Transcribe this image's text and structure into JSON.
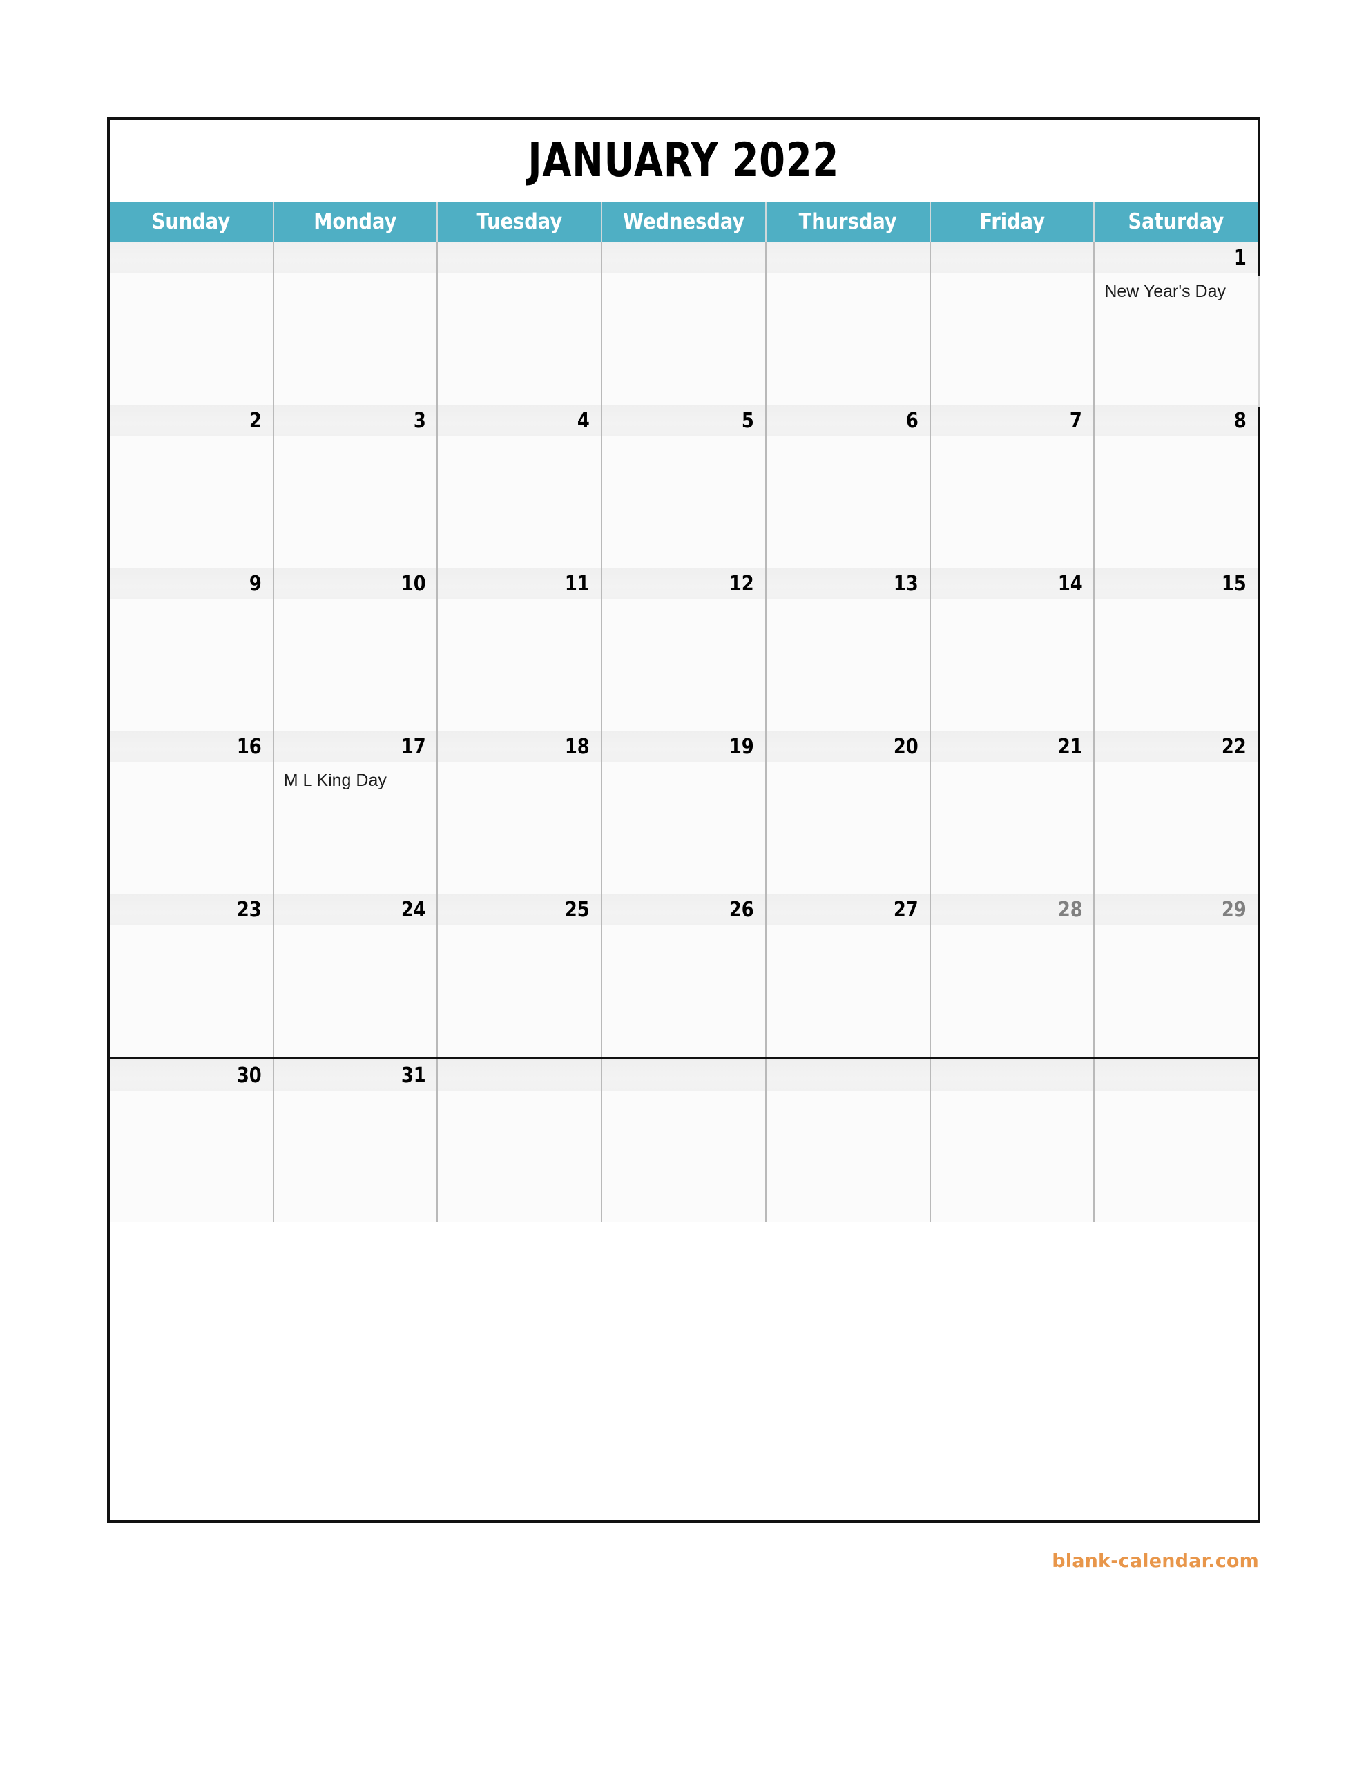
{
  "title": "JANUARY 2022",
  "weekdays": [
    "Sunday",
    "Monday",
    "Tuesday",
    "Wednesday",
    "Thursday",
    "Friday",
    "Saturday"
  ],
  "colors": {
    "header_background": "#4FAFC4",
    "header_text": "#FFFFFF",
    "date_band": "#F1F1F1",
    "cell_background": "#FBFBFB",
    "border": "#111111",
    "grid_line": "#B9B9B9",
    "date_text": "#000000",
    "date_text_muted": "#808080",
    "watermark": "#E8964A"
  },
  "watermark": "blank-calendar.com",
  "weeks": [
    {
      "tall": true,
      "thick_top": false,
      "days": [
        {
          "date": "",
          "event": "",
          "muted": false
        },
        {
          "date": "",
          "event": "",
          "muted": false
        },
        {
          "date": "",
          "event": "",
          "muted": false
        },
        {
          "date": "",
          "event": "",
          "muted": false
        },
        {
          "date": "",
          "event": "",
          "muted": false
        },
        {
          "date": "",
          "event": "",
          "muted": false
        },
        {
          "date": "1",
          "event": "New Year's Day",
          "muted": false
        }
      ]
    },
    {
      "tall": true,
      "thick_top": false,
      "days": [
        {
          "date": "2",
          "event": "",
          "muted": false
        },
        {
          "date": "3",
          "event": "",
          "muted": false
        },
        {
          "date": "4",
          "event": "",
          "muted": false
        },
        {
          "date": "5",
          "event": "",
          "muted": false
        },
        {
          "date": "6",
          "event": "",
          "muted": false
        },
        {
          "date": "7",
          "event": "",
          "muted": false
        },
        {
          "date": "8",
          "event": "",
          "muted": false
        }
      ]
    },
    {
      "tall": true,
      "thick_top": false,
      "days": [
        {
          "date": "9",
          "event": "",
          "muted": false
        },
        {
          "date": "10",
          "event": "",
          "muted": false
        },
        {
          "date": "11",
          "event": "",
          "muted": false
        },
        {
          "date": "12",
          "event": "",
          "muted": false
        },
        {
          "date": "13",
          "event": "",
          "muted": false
        },
        {
          "date": "14",
          "event": "",
          "muted": false
        },
        {
          "date": "15",
          "event": "",
          "muted": false
        }
      ]
    },
    {
      "tall": true,
      "thick_top": false,
      "days": [
        {
          "date": "16",
          "event": "",
          "muted": false
        },
        {
          "date": "17",
          "event": "M L King Day",
          "muted": false
        },
        {
          "date": "18",
          "event": "",
          "muted": false
        },
        {
          "date": "19",
          "event": "",
          "muted": false
        },
        {
          "date": "20",
          "event": "",
          "muted": false
        },
        {
          "date": "21",
          "event": "",
          "muted": false
        },
        {
          "date": "22",
          "event": "",
          "muted": false
        }
      ]
    },
    {
      "tall": true,
      "thick_top": false,
      "days": [
        {
          "date": "23",
          "event": "",
          "muted": false
        },
        {
          "date": "24",
          "event": "",
          "muted": false
        },
        {
          "date": "25",
          "event": "",
          "muted": false
        },
        {
          "date": "26",
          "event": "",
          "muted": false
        },
        {
          "date": "27",
          "event": "",
          "muted": false
        },
        {
          "date": "28",
          "event": "",
          "muted": true
        },
        {
          "date": "29",
          "event": "",
          "muted": true
        }
      ]
    },
    {
      "tall": true,
      "thick_top": true,
      "days": [
        {
          "date": "30",
          "event": "",
          "muted": false
        },
        {
          "date": "31",
          "event": "",
          "muted": false
        },
        {
          "date": "",
          "event": "",
          "muted": false
        },
        {
          "date": "",
          "event": "",
          "muted": false
        },
        {
          "date": "",
          "event": "",
          "muted": false
        },
        {
          "date": "",
          "event": "",
          "muted": false
        },
        {
          "date": "",
          "event": "",
          "muted": false
        }
      ]
    }
  ]
}
